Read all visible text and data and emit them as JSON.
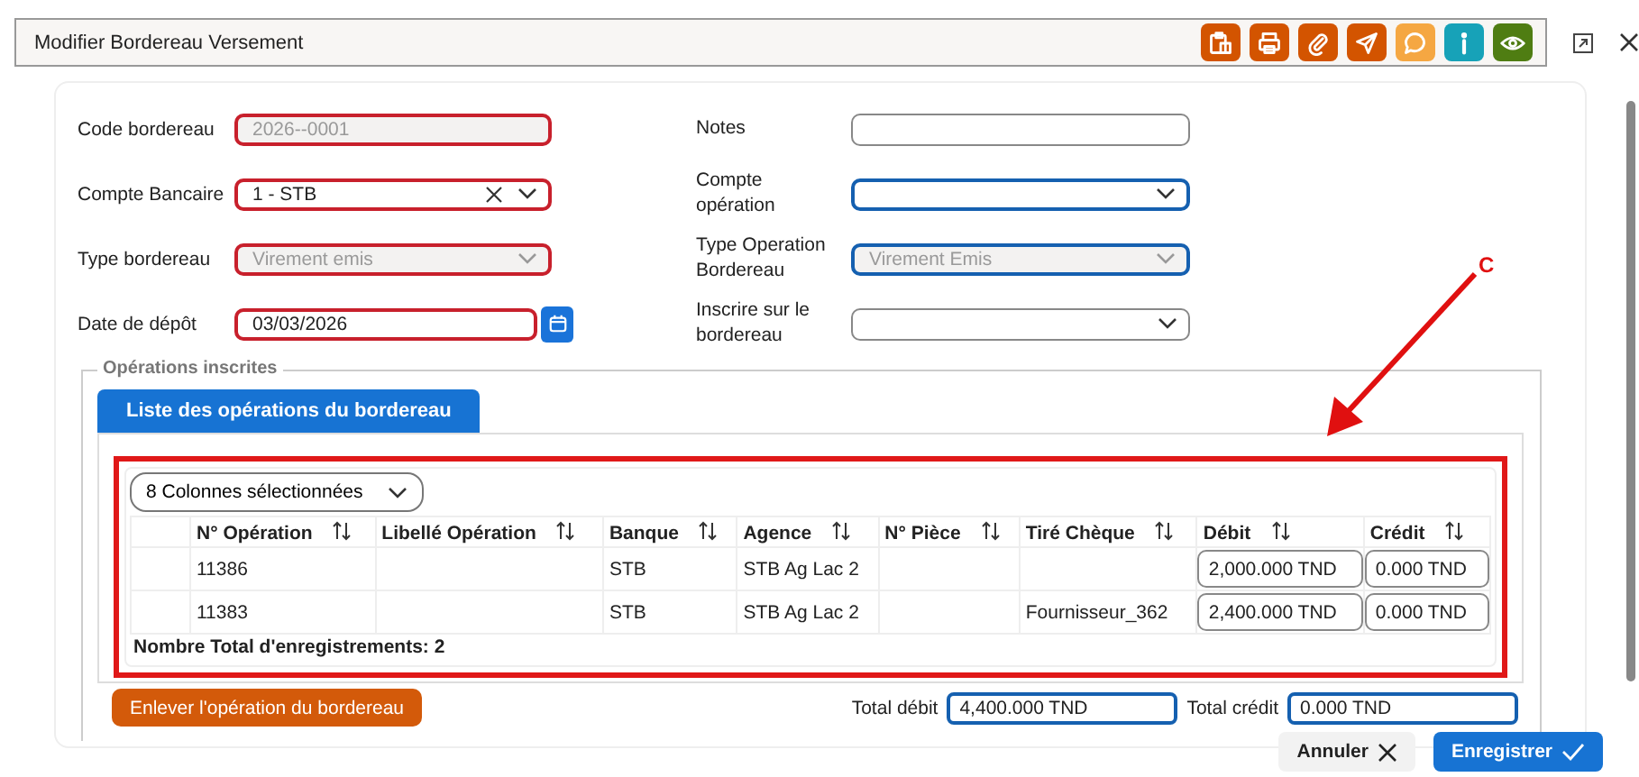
{
  "window": {
    "title": "Modifier Bordereau Versement"
  },
  "toolbar": [
    {
      "kind": "clipboard",
      "color": "#d35400"
    },
    {
      "kind": "print",
      "color": "#d35400"
    },
    {
      "kind": "attach",
      "color": "#d35400"
    },
    {
      "kind": "send",
      "color": "#d35400"
    },
    {
      "kind": "comment",
      "color": "#f5a742"
    },
    {
      "kind": "info",
      "color": "#17a2b8"
    },
    {
      "kind": "view",
      "color": "#4f7d12"
    }
  ],
  "left_fields": [
    {
      "label": "Code bordereau",
      "kind": "text",
      "value": "2026--0001",
      "disabled": true,
      "invalid": true,
      "focused": false,
      "clearable": false
    },
    {
      "label": "Compte Bancaire",
      "kind": "select",
      "value": "1 - STB",
      "disabled": false,
      "invalid": true,
      "focused": false,
      "clearable": true
    },
    {
      "label": "Type bordereau",
      "kind": "select",
      "value": "Virement emis",
      "disabled": true,
      "invalid": true,
      "focused": false,
      "clearable": false
    },
    {
      "label": "Date de dépôt",
      "kind": "date",
      "value": "03/03/2026",
      "disabled": false,
      "invalid": true,
      "focused": false,
      "clearable": false
    }
  ],
  "right_fields": [
    {
      "label": "Notes",
      "kind": "text",
      "disabled": false,
      "invalid": false,
      "focused": false,
      "clearable": false
    },
    {
      "label": "Compte opération",
      "kind": "select",
      "disabled": false,
      "invalid": false,
      "focused": true,
      "clearable": false
    },
    {
      "label": "Type Operation Bordereau",
      "kind": "select",
      "value": "Virement Emis",
      "disabled": true,
      "invalid": false,
      "focused": true,
      "clearable": false
    },
    {
      "label": "Inscrire sur le bordereau",
      "kind": "select",
      "disabled": false,
      "invalid": false,
      "focused": false,
      "clearable": false
    }
  ],
  "section": {
    "legend": "Opérations inscrites",
    "tab": "Liste des opérations du bordereau"
  },
  "table": {
    "column_picker": "8 Colonnes sélectionnées",
    "columns": [
      {
        "label": "N° Opération",
        "kind": "text"
      },
      {
        "label": "Libellé Opération",
        "kind": "text"
      },
      {
        "label": "Banque",
        "kind": "text"
      },
      {
        "label": "Agence",
        "kind": "text"
      },
      {
        "label": "N° Pièce",
        "kind": "text"
      },
      {
        "label": "Tiré Chèque",
        "kind": "text"
      },
      {
        "label": "Débit",
        "kind": "input"
      },
      {
        "label": "Crédit",
        "kind": "input"
      }
    ],
    "rows": [
      [
        "11386",
        null,
        "STB",
        "STB Ag Lac 2",
        null,
        null,
        "2,000.000 TND",
        "0.000 TND"
      ],
      [
        "11383",
        null,
        "STB",
        "STB Ag Lac 2",
        null,
        "Fournisseur_362",
        "2,400.000 TND",
        "0.000 TND"
      ]
    ],
    "footer": "Nombre Total d'enregistrements: 2"
  },
  "remove_button": "Enlever l'opération du bordereau",
  "totals": [
    {
      "label": "Total débit",
      "value": "4,400.000 TND"
    },
    {
      "label": "Total crédit",
      "value": "0.000 TND"
    }
  ],
  "actions": [
    {
      "label": "Annuler",
      "kind": "cancel"
    },
    {
      "label": "Enregistrer",
      "kind": "save"
    }
  ],
  "annotation": {
    "label": "C"
  }
}
